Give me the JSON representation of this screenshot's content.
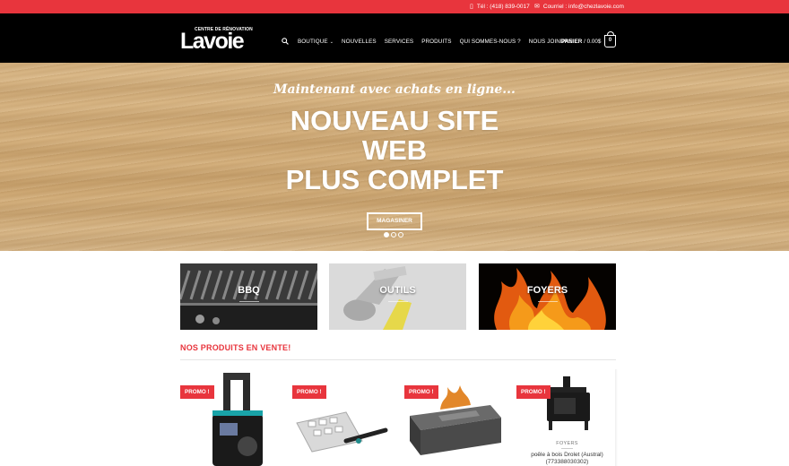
{
  "topbar": {
    "phone": "Tél : (418) 839-0017",
    "email": "Courriel : info@chezlavoie.com",
    "phone_icon": "phone-icon",
    "email_icon": "envelope-icon"
  },
  "header": {
    "logo_tagline": "CENTRE DE RÉNOVATION",
    "logo_word": "Lavoie",
    "search_icon": "search-icon",
    "nav": [
      {
        "label": "BOUTIQUE",
        "has_dropdown": true
      },
      {
        "label": "NOUVELLES"
      },
      {
        "label": "SERVICES"
      },
      {
        "label": "PRODUITS"
      },
      {
        "label": "QUI SOMMES-NOUS ?"
      },
      {
        "label": "NOUS JOINDRE"
      }
    ],
    "cart_label": "PANIER",
    "cart_total": "/ 0.00$",
    "cart_count": "0"
  },
  "hero": {
    "subtitle": "Maintenant avec achats en ligne...",
    "title_lines": [
      "NOUVEAU SITE",
      "WEB",
      "PLUS COMPLET"
    ],
    "button": "MAGASINER",
    "slides": 3,
    "active_slide": 1
  },
  "categories": [
    {
      "label": "BBQ"
    },
    {
      "label": "OUTILS"
    },
    {
      "label": "FOYERS"
    }
  ],
  "section_title": "NOS PRODUITS EN VENTE!",
  "products": [
    {
      "badge": "PROMO !",
      "category": "",
      "name": ""
    },
    {
      "badge": "PROMO !",
      "category": "",
      "name": ""
    },
    {
      "badge": "PROMO !",
      "category": "",
      "name": ""
    },
    {
      "badge": "PROMO !",
      "category": "FOYERS",
      "name": "poêle à bois Drolet (Austral)",
      "sku": "(773388030302)"
    }
  ],
  "colors": {
    "accent": "#e8353d",
    "header_bg": "#000000"
  }
}
